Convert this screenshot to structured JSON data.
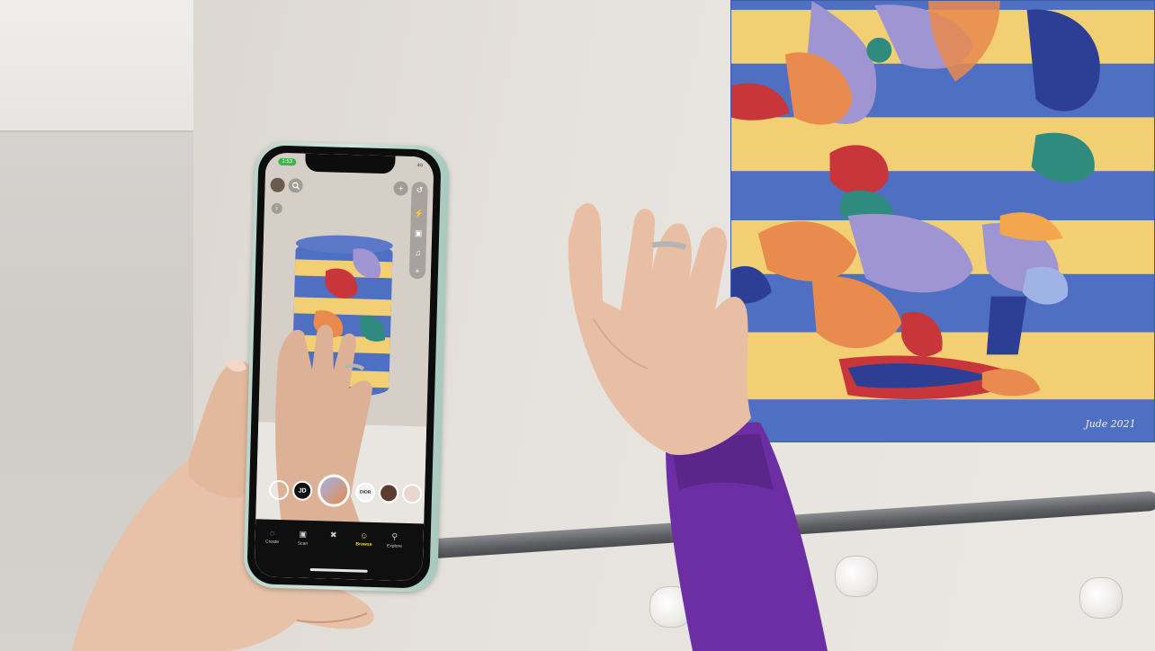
{
  "phone": {
    "status": {
      "time_badge": "1:53",
      "network": "4G"
    },
    "snap_camera": {
      "top_icons": [
        "avatar-icon",
        "search-icon",
        "add-friend-icon",
        "flip-camera-icon"
      ],
      "side_tools": [
        "flash-icon",
        "timer-icon",
        "music-icon",
        "plus-icon"
      ],
      "lens_carousel": [
        {
          "name": "empty-lens",
          "label": ""
        },
        {
          "name": "jd-lens",
          "label": "JD"
        },
        {
          "name": "painting-lens",
          "label": ""
        },
        {
          "name": "dior-lens",
          "label": "DIOR"
        },
        {
          "name": "portrait-lens",
          "label": ""
        },
        {
          "name": "face-lens",
          "label": ""
        }
      ],
      "bottom_nav": [
        {
          "label": "Create",
          "icon": "create-icon",
          "active": false
        },
        {
          "label": "Scan",
          "icon": "scan-icon",
          "active": false
        },
        {
          "label": "",
          "icon": "close-icon",
          "active": false
        },
        {
          "label": "Browse",
          "icon": "browse-icon",
          "active": true
        },
        {
          "label": "Explore",
          "icon": "explore-icon",
          "active": false
        }
      ]
    }
  },
  "painting": {
    "signature": "Jude 2021",
    "colors": {
      "blue": "#4f6fc2",
      "yellow": "#f2cf72",
      "lavender": "#9f95d2",
      "orange": "#e98a4f",
      "red": "#c8353a",
      "teal": "#2f8b7e"
    }
  },
  "accent": {
    "sleeve": "#6b2fa3",
    "active_nav": "#f5e12a",
    "phone_frame": "#bcd8cf"
  }
}
